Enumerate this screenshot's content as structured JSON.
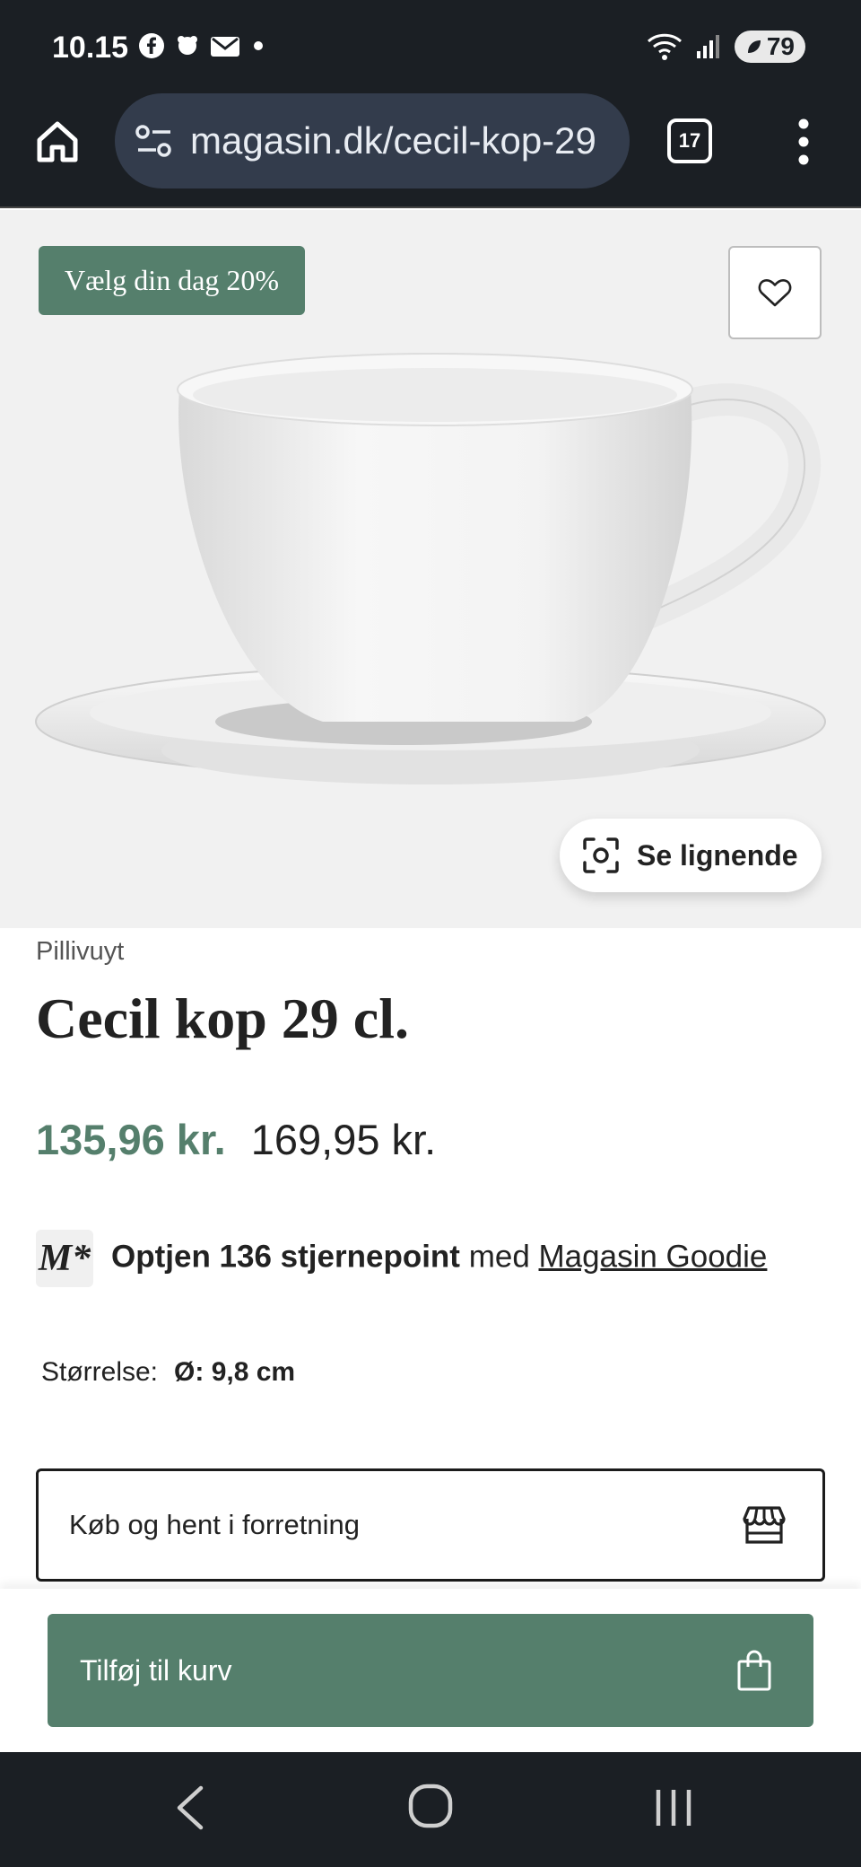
{
  "status_bar": {
    "time": "10.15",
    "battery": "79",
    "icons_left": [
      "facebook-icon",
      "dot-icon",
      "mail-icon",
      "notification-dot"
    ],
    "icons_right": [
      "wifi-icon",
      "signal-icon",
      "battery-icon"
    ]
  },
  "browser": {
    "url": "magasin.dk/cecil-kop-29",
    "tab_count": "17"
  },
  "product": {
    "promo_badge": "Vælg din dag 20%",
    "similar_button": "Se lignende",
    "brand": "Pillivuyt",
    "title": "Cecil kop 29 cl.",
    "price_sale": "135,96 kr.",
    "price_original": "169,95 kr.",
    "points_logo": "M*",
    "points_bold": "Optjen 136 stjernepoint",
    "points_mid": " med ",
    "points_link": "Magasin Goodie",
    "size_label": "Størrelse:",
    "size_value": "Ø: 9,8 cm",
    "store_button": "Køb og hent i forretning",
    "cart_button": "Tilføj til kurv"
  },
  "colors": {
    "accent_green": "#557f6c",
    "chrome_dark": "#1b1f24",
    "url_pill": "#333c4c",
    "hero_bg": "#f1f1f1"
  }
}
